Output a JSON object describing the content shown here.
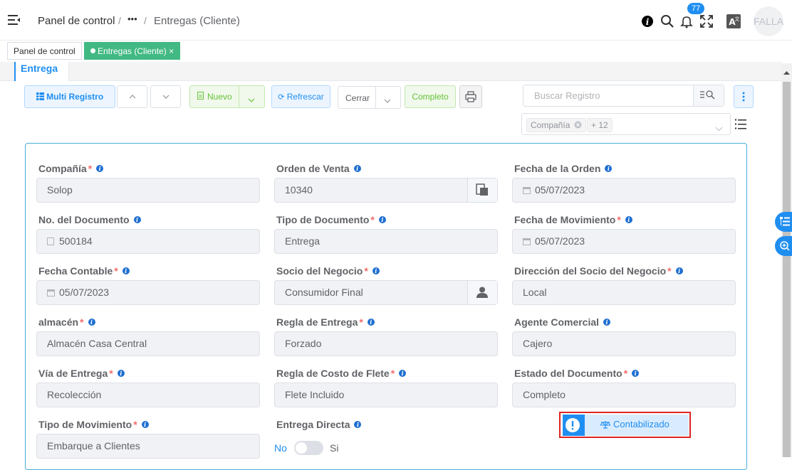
{
  "header": {
    "breadcrumb": [
      "Panel de control",
      "•••",
      "Entregas (Cliente)"
    ],
    "notification_count": "77",
    "avatar_text": "FALLA",
    "icons": [
      "menu-fold-icon",
      "info-icon",
      "search-icon",
      "bell-icon",
      "fullscreen-icon",
      "translate-icon"
    ]
  },
  "tags": [
    {
      "label": "Panel de control",
      "active": false
    },
    {
      "label": "Entregas (Cliente)",
      "active": true,
      "close": "×"
    }
  ],
  "tab": {
    "label": "Entrega"
  },
  "toolbar": {
    "multi_label": "Multi Registro",
    "nuevo_label": "Nuevo",
    "refrescar_label": "Refrescar",
    "cerrar_label": "Cerrar",
    "completo_label": "Completo",
    "search_placeholder": "Buscar Registro",
    "filter_chip": "Compañía",
    "filter_more": "+ 12"
  },
  "form": {
    "fields": [
      {
        "label": "Compañía",
        "required": true,
        "value": "Solop"
      },
      {
        "label": "Orden de Venta",
        "required": false,
        "value": "10340"
      },
      {
        "label": "Fecha de la Orden",
        "required": false,
        "value": "05/07/2023"
      },
      {
        "label": "No. del Documento",
        "required": false,
        "value": "500184"
      },
      {
        "label": "Tipo de Documento",
        "required": true,
        "value": "Entrega"
      },
      {
        "label": "Fecha de Movimiento",
        "required": true,
        "value": "05/07/2023"
      },
      {
        "label": "Fecha Contable",
        "required": true,
        "value": "05/07/2023"
      },
      {
        "label": "Socio del Negocio",
        "required": true,
        "value": "Consumidor Final"
      },
      {
        "label": "Dirección del Socio del Negocio",
        "required": true,
        "value": "Local"
      },
      {
        "label": "almacén",
        "required": true,
        "value": "Almacén Casa Central"
      },
      {
        "label": "Regla de Entrega",
        "required": true,
        "value": "Forzado"
      },
      {
        "label": "Agente Comercial",
        "required": false,
        "value": "Cajero"
      },
      {
        "label": "Vía de Entrega",
        "required": true,
        "value": "Recolección"
      },
      {
        "label": "Regla de Costo de Flete",
        "required": true,
        "value": "Flete Incluido"
      },
      {
        "label": "Estado del Documento",
        "required": true,
        "value": "Completo"
      },
      {
        "label": "Tipo de Movimiento",
        "required": true,
        "value": "Embarque a Clientes"
      },
      {
        "label": "Entrega Directa",
        "required": false
      }
    ],
    "toggle_no": "No",
    "toggle_si": "Si",
    "status_label": "Contabilizado"
  },
  "colors": {
    "primary": "#1f8ef1",
    "success": "#42b983",
    "required": "#f56c6c",
    "highlight": "#e02424"
  }
}
